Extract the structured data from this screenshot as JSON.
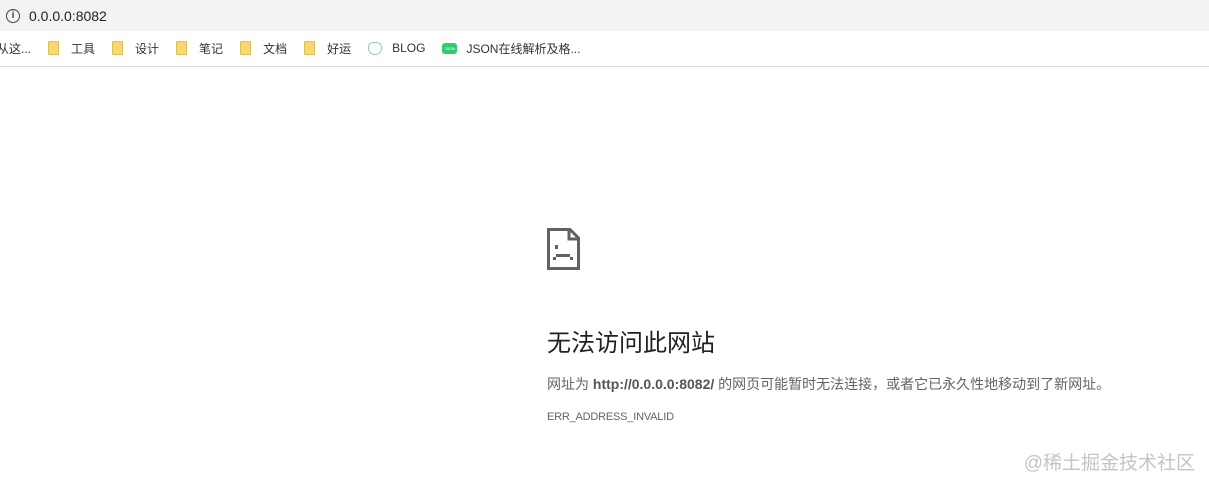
{
  "address_bar": {
    "url": "0.0.0.0:8082"
  },
  "bookmarks": [
    {
      "label": "从这...",
      "icon": "none"
    },
    {
      "label": "工具",
      "icon": "folder-icon"
    },
    {
      "label": "设计",
      "icon": "folder-icon"
    },
    {
      "label": "笔记",
      "icon": "folder-icon"
    },
    {
      "label": "文档",
      "icon": "folder-icon"
    },
    {
      "label": "好运",
      "icon": "folder-icon"
    },
    {
      "label": "BLOG",
      "icon": "blog-favicon"
    },
    {
      "label": "JSON在线解析及格...",
      "icon": "json-favicon",
      "icon_text": "JSON"
    }
  ],
  "error": {
    "title": "无法访问此网站",
    "desc_prefix": "网址为 ",
    "url": "http://0.0.0.0:8082/",
    "desc_suffix": " 的网页可能暂时无法连接，或者它已永久性地移动到了新网址。",
    "code": "ERR_ADDRESS_INVALID"
  },
  "watermark": "@稀土掘金技术社区"
}
